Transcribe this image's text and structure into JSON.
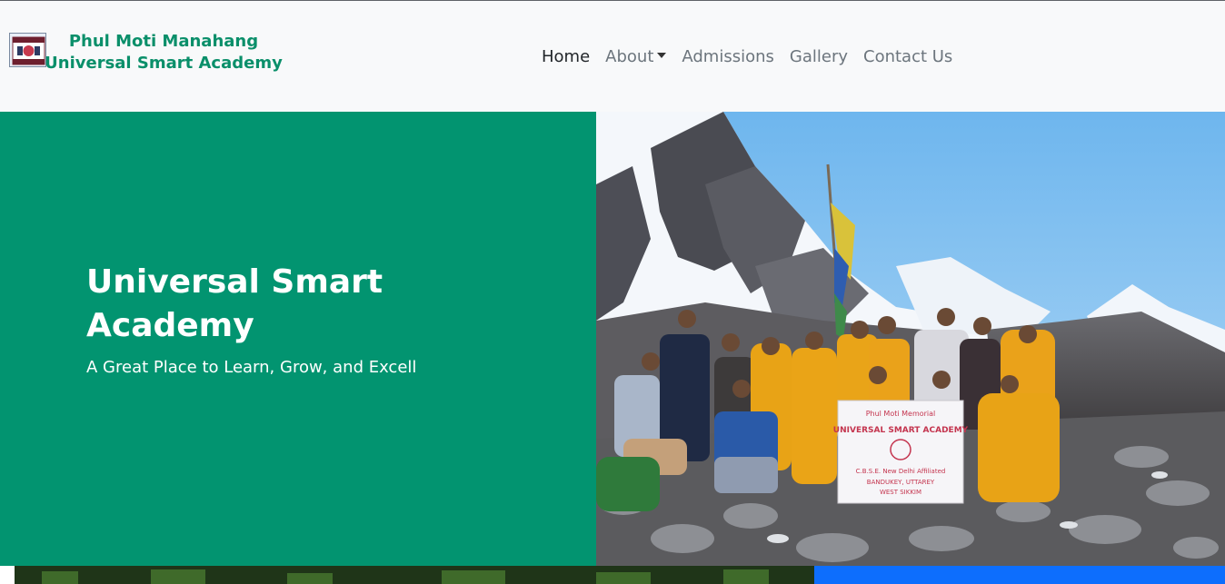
{
  "brand": {
    "line1": "Phul Moti Manahang",
    "line2": "Universal Smart Academy",
    "color": "#0a8f6a"
  },
  "nav": {
    "items": [
      {
        "label": "Home",
        "active": true
      },
      {
        "label": "About",
        "dropdown": true
      },
      {
        "label": "Admissions"
      },
      {
        "label": "Gallery"
      },
      {
        "label": "Contact Us"
      }
    ]
  },
  "hero": {
    "title": "Universal Smart Academy",
    "subtitle": "A Great Place to Learn, Grow, and Excell",
    "background": "#029470",
    "banner_lines": [
      "Phul Moti Memorial",
      "UNIVERSAL SMART ACADEMY",
      "C.B.S.E. New Delhi Affiliated",
      "BANDUKEY, UTTAREY",
      "WEST SIKKIM"
    ]
  },
  "colors": {
    "accent_blue": "#0d6efd",
    "navbar_bg": "#f8f9fa"
  }
}
